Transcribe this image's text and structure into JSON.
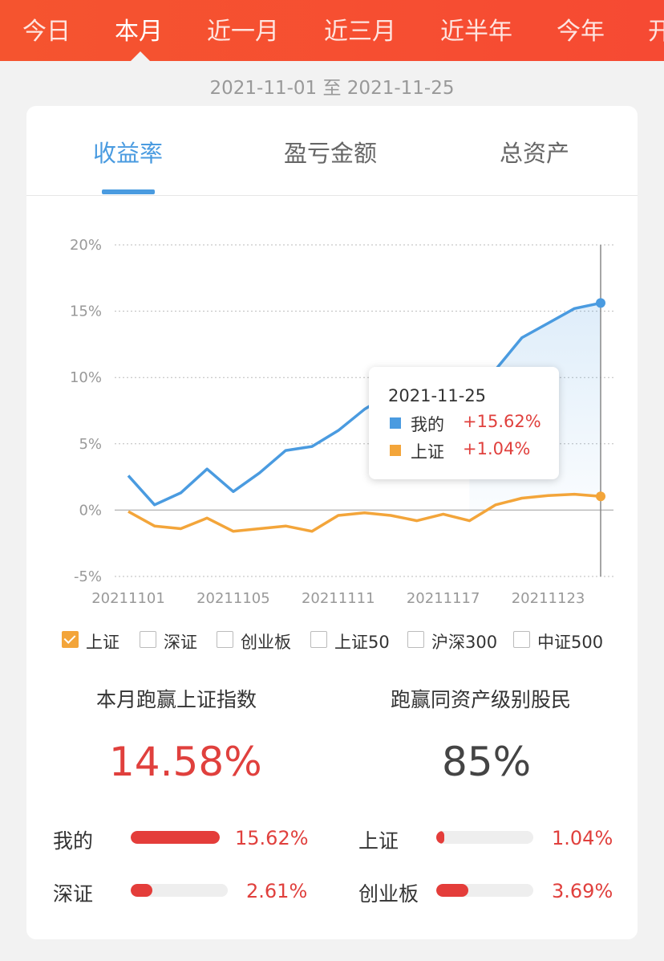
{
  "top_tabs": [
    "今日",
    "本月",
    "近一月",
    "近三月",
    "近半年",
    "今年",
    "开"
  ],
  "active_top_tab": "本月",
  "date_range": "2021-11-01 至 2021-11-25",
  "card_tabs": [
    "收益率",
    "盈亏金额",
    "总资产"
  ],
  "active_card_tab": "收益率",
  "chart_data": {
    "type": "line",
    "x": [
      "20211101",
      "20211102",
      "20211103",
      "20211104",
      "20211105",
      "20211108",
      "20211109",
      "20211110",
      "20211111",
      "20211112",
      "20211115",
      "20211116",
      "20211117",
      "20211118",
      "20211119",
      "20211122",
      "20211123",
      "20211124",
      "20211125"
    ],
    "x_tick_labels": [
      "20211101",
      "20211105",
      "20211111",
      "20211117",
      "20211123"
    ],
    "y_tick_labels": [
      "20%",
      "15%",
      "10%",
      "5%",
      "0%",
      "-5%"
    ],
    "ylim": [
      -5,
      20
    ],
    "series": [
      {
        "name": "我的",
        "color": "#4a9be0",
        "values": [
          2.6,
          0.4,
          1.3,
          3.1,
          1.4,
          2.8,
          4.5,
          4.8,
          6.0,
          7.6,
          8.8,
          8.3,
          8.1,
          9.5,
          10.6,
          13.0,
          14.1,
          15.2,
          15.62
        ]
      },
      {
        "name": "上证",
        "color": "#f3a53a",
        "values": [
          -0.1,
          -1.2,
          -1.4,
          -0.6,
          -1.6,
          -1.4,
          -1.2,
          -1.6,
          -0.4,
          -0.2,
          -0.4,
          -0.8,
          -0.3,
          -0.8,
          0.4,
          0.9,
          1.1,
          1.2,
          1.04
        ]
      }
    ],
    "grid": true
  },
  "tooltip": {
    "date": "2021-11-25",
    "rows": [
      {
        "name": "我的",
        "value": "+15.62%",
        "color": "#4a9be0"
      },
      {
        "name": "上证",
        "value": "+1.04%",
        "color": "#f3a53a"
      }
    ]
  },
  "legend": [
    {
      "label": "上证",
      "checked": true
    },
    {
      "label": "深证",
      "checked": false
    },
    {
      "label": "创业板",
      "checked": false
    },
    {
      "label": "上证50",
      "checked": false
    },
    {
      "label": "沪深300",
      "checked": false
    },
    {
      "label": "中证500",
      "checked": false
    }
  ],
  "stats": {
    "beat_index_title": "本月跑赢上证指数",
    "beat_index_value": "14.58%",
    "beat_peers_title": "跑赢同资产级别股民",
    "beat_peers_value": "85%"
  },
  "bars": [
    {
      "label": "我的",
      "value": "15.62%",
      "fill": 1.0
    },
    {
      "label": "上证",
      "value": "1.04%",
      "fill": 0.08
    },
    {
      "label": "深证",
      "value": "2.61%",
      "fill": 0.22
    },
    {
      "label": "创业板",
      "value": "3.69%",
      "fill": 0.33
    }
  ],
  "colors": {
    "brand": "#f5542f",
    "accent": "#4a9be0",
    "index_line": "#f3a53a",
    "positive": "#e0403d"
  }
}
